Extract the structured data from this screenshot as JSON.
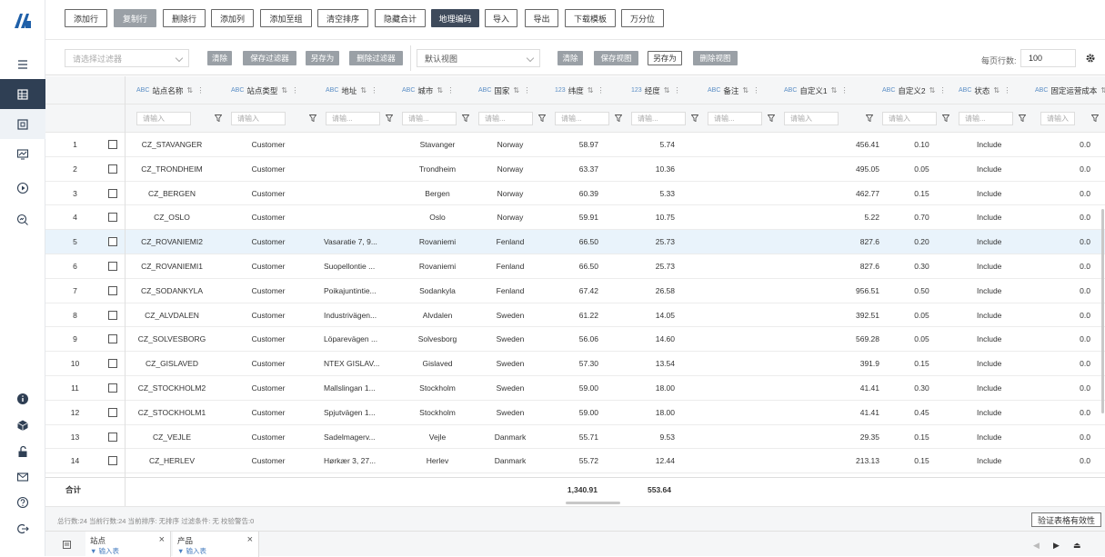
{
  "toolbar": {
    "buttons": [
      "添加行",
      "复制行",
      "删除行",
      "添加列",
      "添加至组",
      "清空排序",
      "隐藏合计",
      "地理编码",
      "导入",
      "导出",
      "下载模板",
      "万分位"
    ]
  },
  "filterbar": {
    "filter_placeholder": "请选择过滤器",
    "clear": "清除",
    "save_filter": "保存过滤器",
    "save_as": "另存为",
    "delete_filter": "删除过滤器",
    "view": "默认视图",
    "clear2": "清除",
    "save_view": "保存视图",
    "save_as2": "另存为",
    "delete_view": "删除视图",
    "page_size_label": "每页行数:",
    "page_size": "100"
  },
  "columns": [
    {
      "type": "ABC",
      "label": "站点名称",
      "placeholder": "请输入"
    },
    {
      "type": "ABC",
      "label": "站点类型",
      "placeholder": "请输入"
    },
    {
      "type": "ABC",
      "label": "地址",
      "placeholder": "请输..."
    },
    {
      "type": "ABC",
      "label": "城市",
      "placeholder": "请输..."
    },
    {
      "type": "ABC",
      "label": "国家",
      "placeholder": "请输..."
    },
    {
      "type": "123",
      "label": "纬度",
      "placeholder": "请输..."
    },
    {
      "type": "123",
      "label": "经度",
      "placeholder": "请输..."
    },
    {
      "type": "ABC",
      "label": "备注",
      "placeholder": "请输..."
    },
    {
      "type": "ABC",
      "label": "自定义1",
      "placeholder": "请输入"
    },
    {
      "type": "ABC",
      "label": "自定义2",
      "placeholder": "请输入"
    },
    {
      "type": "ABC",
      "label": "状态",
      "placeholder": "请输..."
    },
    {
      "type": "ABC",
      "label": "固定运营成本",
      "placeholder": "请输入"
    }
  ],
  "rows": [
    {
      "n": "1",
      "name": "CZ_STAVANGER",
      "type": "Customer",
      "addr": "",
      "city": "Stavanger",
      "country": "Norway",
      "lat": "58.97",
      "lng": "5.74",
      "c1": "456.41",
      "c2": "0.10",
      "status": "Include",
      "cost": "0.0"
    },
    {
      "n": "2",
      "name": "CZ_TRONDHEIM",
      "type": "Customer",
      "addr": "",
      "city": "Trondheim",
      "country": "Norway",
      "lat": "63.37",
      "lng": "10.36",
      "c1": "495.05",
      "c2": "0.05",
      "status": "Include",
      "cost": "0.0"
    },
    {
      "n": "3",
      "name": "CZ_BERGEN",
      "type": "Customer",
      "addr": "",
      "city": "Bergen",
      "country": "Norway",
      "lat": "60.39",
      "lng": "5.33",
      "c1": "462.77",
      "c2": "0.15",
      "status": "Include",
      "cost": "0.0"
    },
    {
      "n": "4",
      "name": "CZ_OSLO",
      "type": "Customer",
      "addr": "",
      "city": "Oslo",
      "country": "Norway",
      "lat": "59.91",
      "lng": "10.75",
      "c1": "5.22",
      "c2": "0.70",
      "status": "Include",
      "cost": "0.0"
    },
    {
      "n": "5",
      "name": "CZ_ROVANIEMI2",
      "type": "Customer",
      "addr": "Vasaratie 7, 9...",
      "city": "Rovaniemi",
      "country": "Fenland",
      "lat": "66.50",
      "lng": "25.73",
      "c1": "827.6",
      "c2": "0.20",
      "status": "Include",
      "cost": "0.0",
      "hl": true
    },
    {
      "n": "6",
      "name": "CZ_ROVANIEMI1",
      "type": "Customer",
      "addr": "Suopellontie ...",
      "city": "Rovaniemi",
      "country": "Fenland",
      "lat": "66.50",
      "lng": "25.73",
      "c1": "827.6",
      "c2": "0.30",
      "status": "Include",
      "cost": "0.0"
    },
    {
      "n": "7",
      "name": "CZ_SODANKYLA",
      "type": "Customer",
      "addr": "Poikajuntintie...",
      "city": "Sodankyla",
      "country": "Fenland",
      "lat": "67.42",
      "lng": "26.58",
      "c1": "956.51",
      "c2": "0.50",
      "status": "Include",
      "cost": "0.0"
    },
    {
      "n": "8",
      "name": "CZ_ALVDALEN",
      "type": "Customer",
      "addr": "Industrivägen...",
      "city": "Alvdalen",
      "country": "Sweden",
      "lat": "61.22",
      "lng": "14.05",
      "c1": "392.51",
      "c2": "0.05",
      "status": "Include",
      "cost": "0.0"
    },
    {
      "n": "9",
      "name": "CZ_SOLVESBORG",
      "type": "Customer",
      "addr": "Löparevägen ...",
      "city": "Solvesborg",
      "country": "Sweden",
      "lat": "56.06",
      "lng": "14.60",
      "c1": "569.28",
      "c2": "0.05",
      "status": "Include",
      "cost": "0.0"
    },
    {
      "n": "10",
      "name": "CZ_GISLAVED",
      "type": "Customer",
      "addr": "NTEX GISLAV...",
      "city": "Gislaved",
      "country": "Sweden",
      "lat": "57.30",
      "lng": "13.54",
      "c1": "391.9",
      "c2": "0.15",
      "status": "Include",
      "cost": "0.0"
    },
    {
      "n": "11",
      "name": "CZ_STOCKHOLM2",
      "type": "Customer",
      "addr": "Mallslingan 1...",
      "city": "Stockholm",
      "country": "Sweden",
      "lat": "59.00",
      "lng": "18.00",
      "c1": "41.41",
      "c2": "0.30",
      "status": "Include",
      "cost": "0.0"
    },
    {
      "n": "12",
      "name": "CZ_STOCKHOLM1",
      "type": "Customer",
      "addr": "Spjutvägen 1...",
      "city": "Stockholm",
      "country": "Sweden",
      "lat": "59.00",
      "lng": "18.00",
      "c1": "41.41",
      "c2": "0.45",
      "status": "Include",
      "cost": "0.0"
    },
    {
      "n": "13",
      "name": "CZ_VEJLE",
      "type": "Customer",
      "addr": "Sadelmagerv...",
      "city": "Vejle",
      "country": "Danmark",
      "lat": "55.71",
      "lng": "9.53",
      "c1": "29.35",
      "c2": "0.15",
      "status": "Include",
      "cost": "0.0"
    },
    {
      "n": "14",
      "name": "CZ_HERLEV",
      "type": "Customer",
      "addr": "Hørkær 3, 27...",
      "city": "Herlev",
      "country": "Danmark",
      "lat": "55.72",
      "lng": "12.44",
      "c1": "213.13",
      "c2": "0.15",
      "status": "Include",
      "cost": "0.0"
    }
  ],
  "total": {
    "label": "合计",
    "lat": "1,340.91",
    "lng": "553.64"
  },
  "status": {
    "text": "总行数:24   当前行数:24   当前排序: 无排序   过滤条件: 无   校验警告:0",
    "validate": "验证表格有效性"
  },
  "tabs": [
    {
      "title": "站点",
      "sub": "▼ 输入表"
    },
    {
      "title": "产品",
      "sub": "▼ 输入表"
    }
  ],
  "colors": {
    "sidebar_active": "#2f3f54",
    "highlight_row": "#e9f3fb",
    "accent": "#5b8ec5"
  }
}
